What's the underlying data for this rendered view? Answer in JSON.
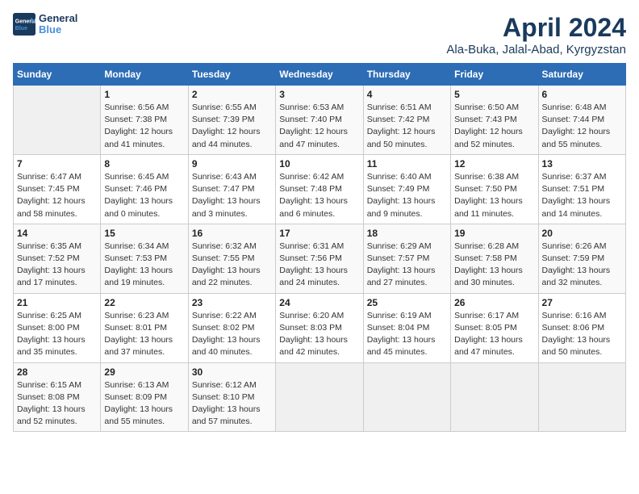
{
  "header": {
    "logo_line1": "General",
    "logo_line2": "Blue",
    "title": "April 2024",
    "subtitle": "Ala-Buka, Jalal-Abad, Kyrgyzstan"
  },
  "days_of_week": [
    "Sunday",
    "Monday",
    "Tuesday",
    "Wednesday",
    "Thursday",
    "Friday",
    "Saturday"
  ],
  "weeks": [
    [
      {
        "num": "",
        "info": ""
      },
      {
        "num": "1",
        "info": "Sunrise: 6:56 AM\nSunset: 7:38 PM\nDaylight: 12 hours\nand 41 minutes."
      },
      {
        "num": "2",
        "info": "Sunrise: 6:55 AM\nSunset: 7:39 PM\nDaylight: 12 hours\nand 44 minutes."
      },
      {
        "num": "3",
        "info": "Sunrise: 6:53 AM\nSunset: 7:40 PM\nDaylight: 12 hours\nand 47 minutes."
      },
      {
        "num": "4",
        "info": "Sunrise: 6:51 AM\nSunset: 7:42 PM\nDaylight: 12 hours\nand 50 minutes."
      },
      {
        "num": "5",
        "info": "Sunrise: 6:50 AM\nSunset: 7:43 PM\nDaylight: 12 hours\nand 52 minutes."
      },
      {
        "num": "6",
        "info": "Sunrise: 6:48 AM\nSunset: 7:44 PM\nDaylight: 12 hours\nand 55 minutes."
      }
    ],
    [
      {
        "num": "7",
        "info": "Sunrise: 6:47 AM\nSunset: 7:45 PM\nDaylight: 12 hours\nand 58 minutes."
      },
      {
        "num": "8",
        "info": "Sunrise: 6:45 AM\nSunset: 7:46 PM\nDaylight: 13 hours\nand 0 minutes."
      },
      {
        "num": "9",
        "info": "Sunrise: 6:43 AM\nSunset: 7:47 PM\nDaylight: 13 hours\nand 3 minutes."
      },
      {
        "num": "10",
        "info": "Sunrise: 6:42 AM\nSunset: 7:48 PM\nDaylight: 13 hours\nand 6 minutes."
      },
      {
        "num": "11",
        "info": "Sunrise: 6:40 AM\nSunset: 7:49 PM\nDaylight: 13 hours\nand 9 minutes."
      },
      {
        "num": "12",
        "info": "Sunrise: 6:38 AM\nSunset: 7:50 PM\nDaylight: 13 hours\nand 11 minutes."
      },
      {
        "num": "13",
        "info": "Sunrise: 6:37 AM\nSunset: 7:51 PM\nDaylight: 13 hours\nand 14 minutes."
      }
    ],
    [
      {
        "num": "14",
        "info": "Sunrise: 6:35 AM\nSunset: 7:52 PM\nDaylight: 13 hours\nand 17 minutes."
      },
      {
        "num": "15",
        "info": "Sunrise: 6:34 AM\nSunset: 7:53 PM\nDaylight: 13 hours\nand 19 minutes."
      },
      {
        "num": "16",
        "info": "Sunrise: 6:32 AM\nSunset: 7:55 PM\nDaylight: 13 hours\nand 22 minutes."
      },
      {
        "num": "17",
        "info": "Sunrise: 6:31 AM\nSunset: 7:56 PM\nDaylight: 13 hours\nand 24 minutes."
      },
      {
        "num": "18",
        "info": "Sunrise: 6:29 AM\nSunset: 7:57 PM\nDaylight: 13 hours\nand 27 minutes."
      },
      {
        "num": "19",
        "info": "Sunrise: 6:28 AM\nSunset: 7:58 PM\nDaylight: 13 hours\nand 30 minutes."
      },
      {
        "num": "20",
        "info": "Sunrise: 6:26 AM\nSunset: 7:59 PM\nDaylight: 13 hours\nand 32 minutes."
      }
    ],
    [
      {
        "num": "21",
        "info": "Sunrise: 6:25 AM\nSunset: 8:00 PM\nDaylight: 13 hours\nand 35 minutes."
      },
      {
        "num": "22",
        "info": "Sunrise: 6:23 AM\nSunset: 8:01 PM\nDaylight: 13 hours\nand 37 minutes."
      },
      {
        "num": "23",
        "info": "Sunrise: 6:22 AM\nSunset: 8:02 PM\nDaylight: 13 hours\nand 40 minutes."
      },
      {
        "num": "24",
        "info": "Sunrise: 6:20 AM\nSunset: 8:03 PM\nDaylight: 13 hours\nand 42 minutes."
      },
      {
        "num": "25",
        "info": "Sunrise: 6:19 AM\nSunset: 8:04 PM\nDaylight: 13 hours\nand 45 minutes."
      },
      {
        "num": "26",
        "info": "Sunrise: 6:17 AM\nSunset: 8:05 PM\nDaylight: 13 hours\nand 47 minutes."
      },
      {
        "num": "27",
        "info": "Sunrise: 6:16 AM\nSunset: 8:06 PM\nDaylight: 13 hours\nand 50 minutes."
      }
    ],
    [
      {
        "num": "28",
        "info": "Sunrise: 6:15 AM\nSunset: 8:08 PM\nDaylight: 13 hours\nand 52 minutes."
      },
      {
        "num": "29",
        "info": "Sunrise: 6:13 AM\nSunset: 8:09 PM\nDaylight: 13 hours\nand 55 minutes."
      },
      {
        "num": "30",
        "info": "Sunrise: 6:12 AM\nSunset: 8:10 PM\nDaylight: 13 hours\nand 57 minutes."
      },
      {
        "num": "",
        "info": ""
      },
      {
        "num": "",
        "info": ""
      },
      {
        "num": "",
        "info": ""
      },
      {
        "num": "",
        "info": ""
      }
    ]
  ]
}
